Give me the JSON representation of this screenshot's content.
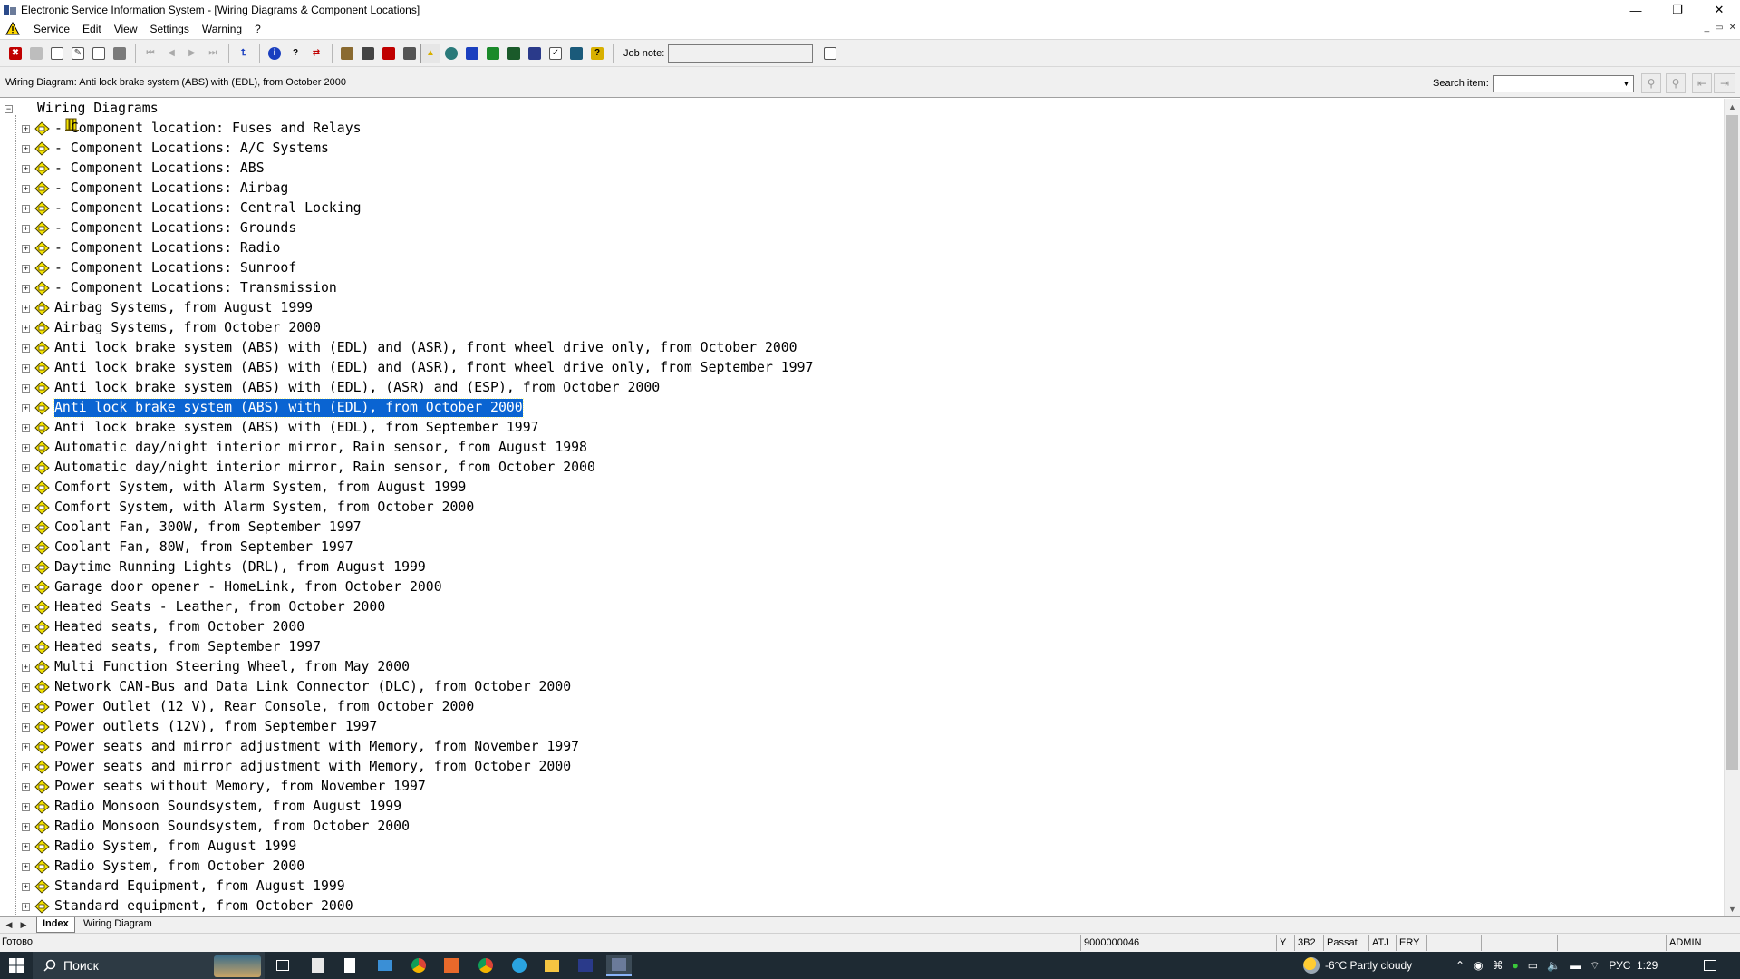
{
  "window": {
    "title": "Electronic Service Information System - [Wiring Diagrams & Component Locations]",
    "controls": [
      "—",
      "❐",
      "✕"
    ]
  },
  "menu": {
    "items": [
      "Service",
      "Edit",
      "View",
      "Settings",
      "Warning",
      "?"
    ],
    "mdi_controls": [
      "_",
      "▭",
      "✕"
    ]
  },
  "toolbar": {
    "job_note_label": "Job note:",
    "job_note_value": ""
  },
  "infobar": {
    "current_item": "Wiring Diagram: Anti lock brake system (ABS) with (EDL), from October 2000",
    "search_label": "Search item:",
    "search_value": ""
  },
  "tree": {
    "root": "Wiring Diagrams",
    "items": [
      "- Component location: Fuses and Relays",
      "- Component Locations: A/C Systems",
      "- Component Locations: ABS",
      "- Component Locations: Airbag",
      "- Component Locations: Central Locking",
      "- Component Locations: Grounds",
      "- Component Locations: Radio",
      "- Component Locations: Sunroof",
      "- Component Locations: Transmission",
      "Airbag Systems, from August 1999",
      "Airbag Systems, from October 2000",
      "Anti lock brake system (ABS) with (EDL) and (ASR), front wheel drive only, from October 2000",
      "Anti lock brake system (ABS) with (EDL) and (ASR), front wheel drive only, from September 1997",
      "Anti lock brake system (ABS) with (EDL), (ASR) and (ESP), from October 2000",
      "Anti lock brake system (ABS) with (EDL), from October 2000",
      "Anti lock brake system (ABS) with (EDL), from September 1997",
      "Automatic day/night interior mirror, Rain sensor, from August 1998",
      "Automatic day/night interior mirror, Rain sensor, from October 2000",
      "Comfort System, with Alarm System, from August 1999",
      "Comfort System, with Alarm System, from October 2000",
      "Coolant Fan, 300W, from September 1997",
      "Coolant Fan, 80W, from September 1997",
      "Daytime Running Lights (DRL), from August 1999",
      "Garage door opener - HomeLink, from October 2000",
      "Heated Seats - Leather, from October 2000",
      "Heated seats, from October 2000",
      "Heated seats, from September 1997",
      "Multi Function Steering Wheel, from May 2000",
      "Network CAN-Bus and Data Link Connector (DLC), from October 2000",
      "Power Outlet (12 V), Rear Console, from October 2000",
      "Power outlets (12V), from September 1997",
      "Power seats and mirror adjustment with Memory, from November 1997",
      "Power seats and mirror adjustment with Memory, from October 2000",
      "Power seats without Memory, from November 1997",
      "Radio Monsoon Soundsystem, from August 1999",
      "Radio Monsoon Soundsystem, from October 2000",
      "Radio System, from August 1999",
      "Radio System, from October 2000",
      "Standard Equipment, from August 1999",
      "Standard equipment, from October 2000"
    ],
    "selected_index": 14,
    "expander_glyph": "+",
    "root_expander_glyph": "−"
  },
  "tabs": [
    "Index",
    "Wiring Diagram"
  ],
  "status": {
    "left": "Готово",
    "cells": [
      "9000000046",
      "",
      "Y",
      "3B2",
      "Passat",
      "ATJ",
      "ERY",
      "",
      "",
      "",
      "ADMIN"
    ]
  },
  "taskbar": {
    "search_placeholder": "Поиск",
    "weather": "-6°C  Partly cloudy",
    "lang": "РУС",
    "time": "1:29"
  },
  "colors": {
    "selection": "#0a64d2",
    "node_icon": "#f5e400",
    "taskbar": "#1e2a33"
  }
}
